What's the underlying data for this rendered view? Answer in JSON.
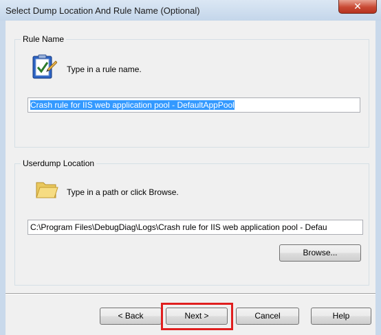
{
  "window": {
    "title": "Select Dump Location And Rule Name (Optional)",
    "close_glyph": "✕"
  },
  "rule_name_group": {
    "legend": "Rule Name",
    "icon": "clipboard-check-icon",
    "hint": "Type in a rule name.",
    "input_value": "Crash rule for IIS web application pool - DefaultAppPool"
  },
  "userdump_group": {
    "legend": "Userdump Location",
    "icon": "folder-icon",
    "hint": "Type in a path or click Browse.",
    "input_value": "C:\\Program Files\\DebugDiag\\Logs\\Crash rule for IIS web application pool - Defau",
    "browse_label": "Browse..."
  },
  "buttons": {
    "back": "< Back",
    "next": "Next >",
    "cancel": "Cancel",
    "help": "Help"
  },
  "colors": {
    "selection": "#3399ff",
    "highlight": "#e01e1e",
    "close_button": "#c94a34"
  }
}
